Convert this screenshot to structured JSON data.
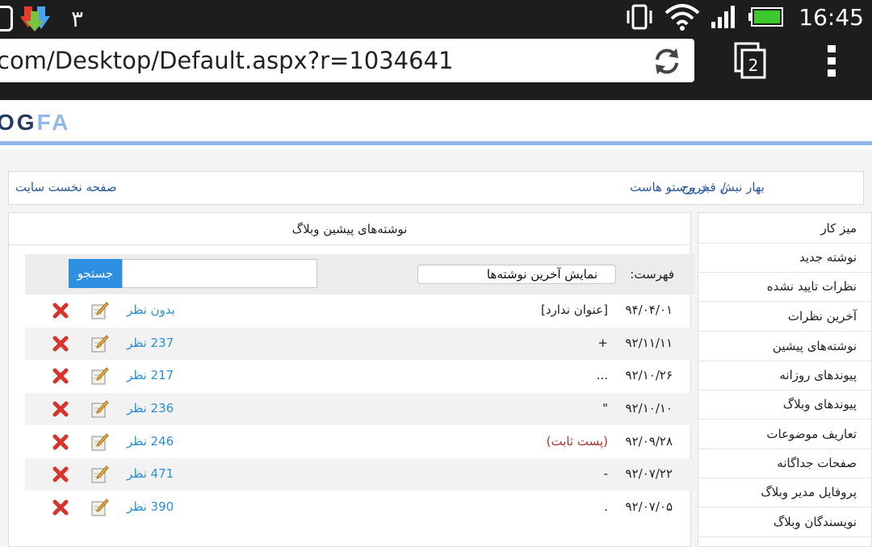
{
  "status_bar": {
    "notification_count": "۳",
    "time": "16:45"
  },
  "browser": {
    "url": "com/Desktop/Default.aspx?r=1034641",
    "tab_count": "2"
  },
  "logo": {
    "dark": "OG",
    "light": "FA"
  },
  "topline": {
    "home_link": "صفحه نخست سایت",
    "user_text": "بهار نبش قبر پرستو هاست",
    "separator": "/",
    "logout_link": "خروج"
  },
  "sidebar": {
    "items": [
      {
        "label": "میز کار"
      },
      {
        "label": "نوشته جدید"
      },
      {
        "label": "نظرات تایید نشده"
      },
      {
        "label": "آخرین نظرات"
      },
      {
        "label": "نوشته‌های پیشین"
      },
      {
        "label": "پیوندهای روزانه"
      },
      {
        "label": "پیوندهای وبلاگ"
      },
      {
        "label": "تعاریف موضوعات"
      },
      {
        "label": "صفحات جداگانه"
      },
      {
        "label": "پروفایل مدیر وبلاگ"
      },
      {
        "label": "نویسندگان وبلاگ"
      }
    ]
  },
  "main": {
    "title": "نوشته‌های پیشین وبلاگ",
    "filter_label": "فهرست:",
    "filter_value": "نمایش آخرین نوشته‌ها",
    "search_button": "جستجو",
    "search_placeholder": ""
  },
  "posts": [
    {
      "date": "۹۴/۰۴/۰۱",
      "title": "[عنوان ندارد]",
      "comments": "بدون نظر",
      "sticky": false
    },
    {
      "date": "۹۲/۱۱/۱۱",
      "title": "+",
      "comments": "237 نظر",
      "sticky": false
    },
    {
      "date": "۹۲/۱۰/۲۶",
      "title": "...",
      "comments": "217 نظر",
      "sticky": false
    },
    {
      "date": "۹۲/۱۰/۱۰",
      "title": "\"",
      "comments": "236 نظر",
      "sticky": false
    },
    {
      "date": "۹۲/۰۹/۲۸",
      "title": "(پست ثابت)",
      "comments": "246 نظر",
      "sticky": true
    },
    {
      "date": "۹۲/۰۷/۲۲",
      "title": "-",
      "comments": "471 نظر",
      "sticky": false
    },
    {
      "date": "۹۲/۰۷/۰۵",
      "title": ".",
      "comments": "390 نظر",
      "sticky": false
    }
  ],
  "colors": {
    "status_bg": "#1d1d1d",
    "accent_blue": "#2d8fe0",
    "link_blue": "#2b5a9a",
    "comment_blue": "#2b8fd0",
    "sticky_red": "#b03030",
    "delete_red": "#d9342b",
    "battery_green": "#3ec82e"
  }
}
